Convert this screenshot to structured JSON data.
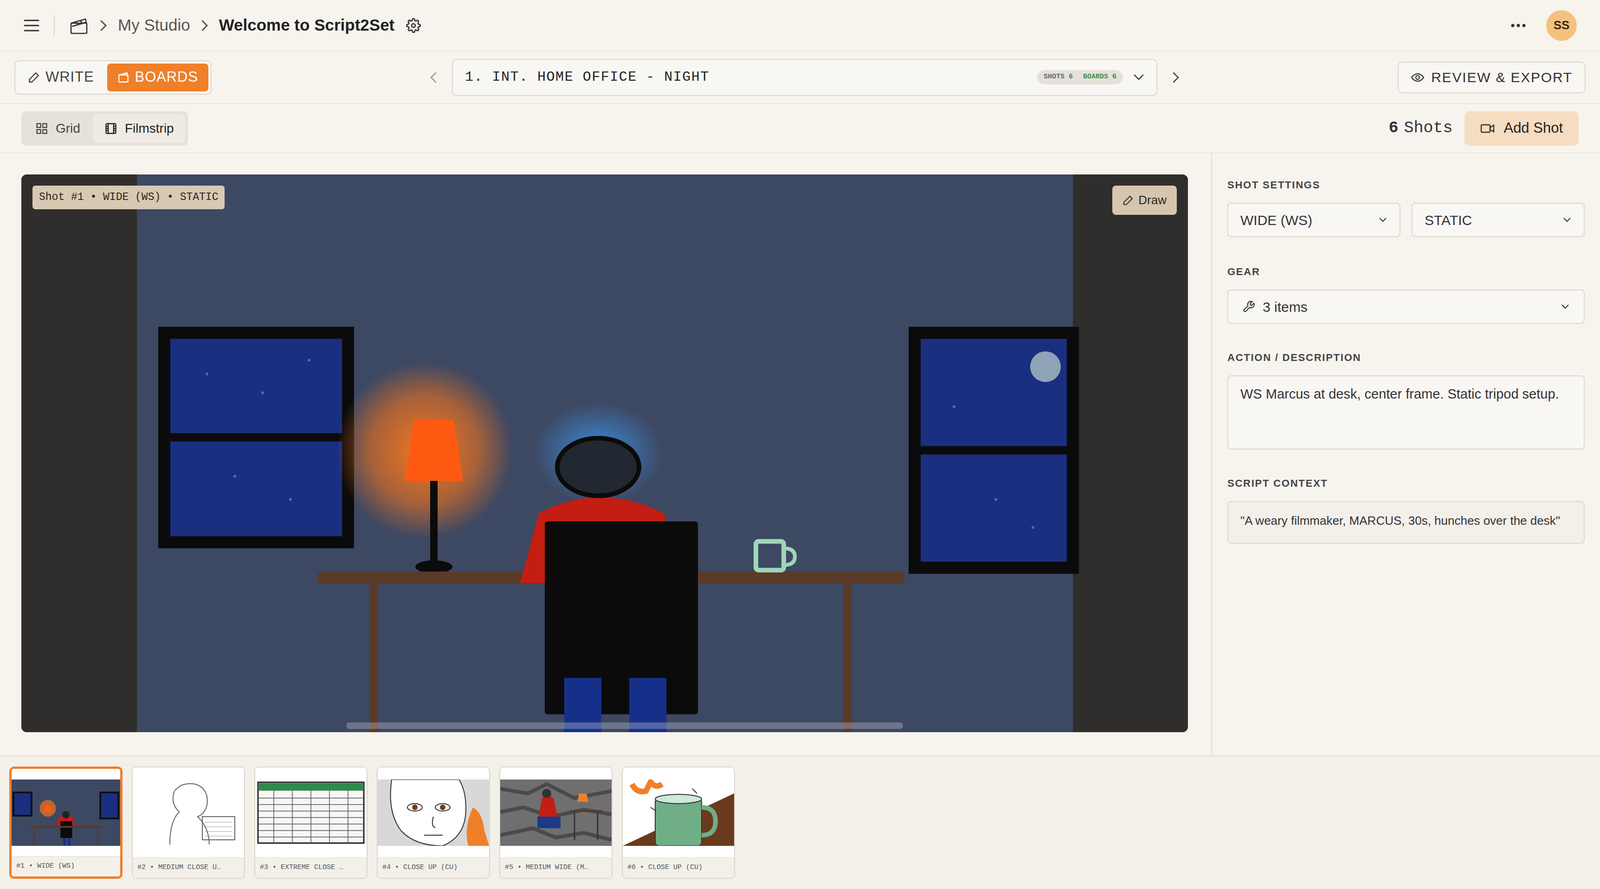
{
  "breadcrumb": {
    "studio": "My Studio",
    "project": "Welcome to Script2Set"
  },
  "user": {
    "initials": "SS"
  },
  "mode_tabs": [
    {
      "label": "WRITE",
      "selected": false
    },
    {
      "label": "BOARDS",
      "selected": true
    }
  ],
  "scene": {
    "title": "1. INT. HOME OFFICE - NIGHT",
    "shots_badge": "SHOTS 6",
    "boards_badge": "BOARDS 6"
  },
  "review_button": "REVIEW & EXPORT",
  "view_tabs": [
    {
      "label": "Grid",
      "selected": false
    },
    {
      "label": "Filmstrip",
      "selected": true
    }
  ],
  "shot_count": {
    "count": "6",
    "label": "Shots"
  },
  "add_shot": "Add Shot",
  "canvas": {
    "label": "Shot #1 • WIDE (WS) • STATIC",
    "draw_button": "Draw"
  },
  "panel": {
    "shot_settings_label": "SHOT SETTINGS",
    "shot_size": "WIDE (WS)",
    "movement": "STATIC",
    "gear_label": "GEAR",
    "gear_value": "3 items",
    "action_label": "ACTION / DESCRIPTION",
    "action_text": "WS Marcus at desk, center frame. Static tripod setup.",
    "context_label": "SCRIPT CONTEXT",
    "context_text": "\"A weary filmmaker, MARCUS, 30s, hunches over the desk\""
  },
  "filmstrip": [
    {
      "label": "#1 • WIDE (WS)",
      "selected": true,
      "kind": "night"
    },
    {
      "label": "#2 • MEDIUM CLOSE U…",
      "selected": false,
      "kind": "sketch"
    },
    {
      "label": "#3 • EXTREME CLOSE …",
      "selected": false,
      "kind": "sheet"
    },
    {
      "label": "#4 • CLOSE UP (CU)",
      "selected": false,
      "kind": "face"
    },
    {
      "label": "#5 • MEDIUM WIDE (M…",
      "selected": false,
      "kind": "desk"
    },
    {
      "label": "#6 • CLOSE UP (CU)",
      "selected": false,
      "kind": "mug"
    }
  ]
}
